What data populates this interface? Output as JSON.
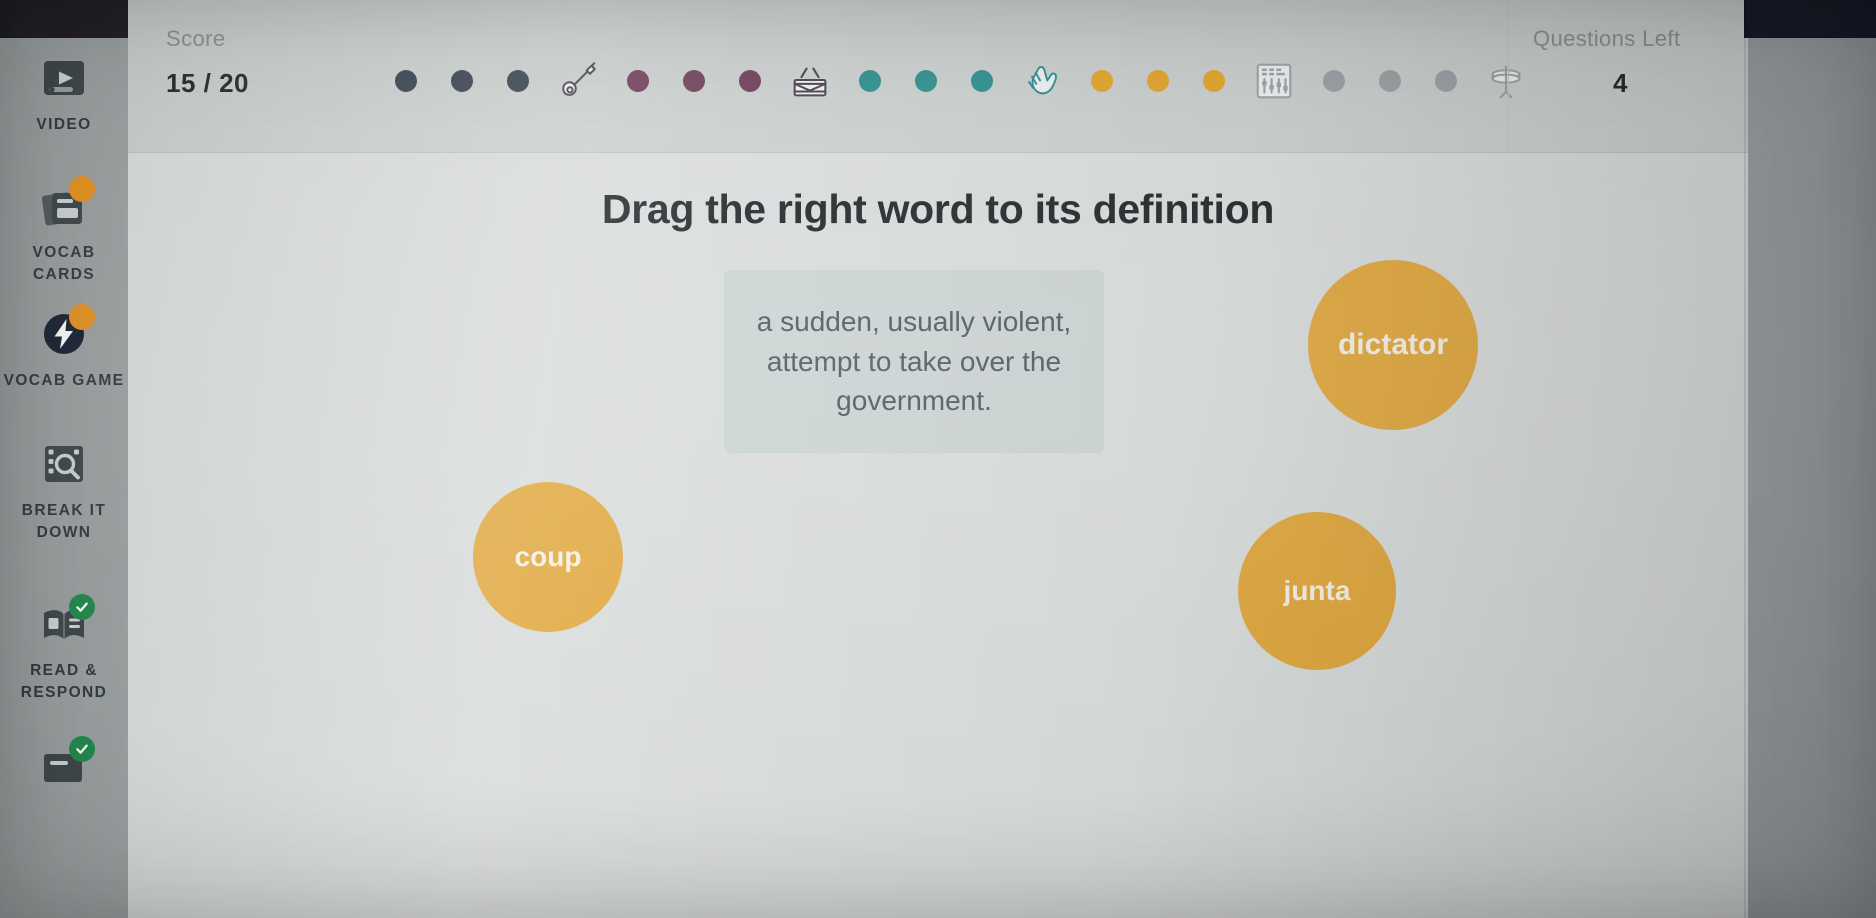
{
  "app": {
    "title": "Vocab Game"
  },
  "sidebar": {
    "items": [
      {
        "label": "VIDEO",
        "icon": "video-play-icon",
        "badge": "none"
      },
      {
        "label": "VOCAB CARDS",
        "icon": "flash-cards-icon",
        "badge": "orange"
      },
      {
        "label": "VOCAB GAME",
        "icon": "lightning-bolt-icon",
        "badge": "orange"
      },
      {
        "label": "BREAK IT\nDOWN",
        "icon": "film-search-icon",
        "badge": "none"
      },
      {
        "label": "READ &\nRESPOND",
        "icon": "open-book-icon",
        "badge": "green"
      },
      {
        "label": "",
        "icon": "write-note-icon",
        "badge": "green"
      }
    ]
  },
  "header": {
    "score_caption": "Score",
    "score_value": "15 / 20",
    "questions_left_caption": "Questions Left",
    "questions_left_value": "4"
  },
  "progress": {
    "milestone_icons": [
      "guitar-icon",
      "drum-icon",
      "clapping-hands-icon",
      "mixer-icon",
      "cymbal-icon"
    ],
    "segments": [
      {
        "color": "#2f3a48",
        "dots": 3,
        "icon": "guitar-icon"
      },
      {
        "color": "#6b3b56",
        "dots": 3,
        "icon": "drum-icon"
      },
      {
        "color": "#2b8e8c",
        "dots": 3,
        "icon": "clapping-hands-icon"
      },
      {
        "color": "#e0a329",
        "dots": 3,
        "icon": "mixer-icon"
      },
      {
        "color": "#9aa1a4",
        "dots": 3,
        "icon": "cymbal-icon"
      }
    ]
  },
  "game": {
    "prompt": "Drag the right word to its definition",
    "definition": "a sudden, usually violent, attempt to take over the government.",
    "word_bubbles": [
      {
        "id": "dictator",
        "label": "dictator"
      },
      {
        "id": "coup",
        "label": "coup"
      },
      {
        "id": "junta",
        "label": "junta"
      }
    ]
  },
  "colors": {
    "bubble": "#e0a63a",
    "accent_orange": "#e8921f",
    "accent_green": "#1f8a4c",
    "app_bg": "#d7dbda",
    "header_bg": "#c9cecd",
    "sidebar_bg": "#9ba0a1",
    "text_dark": "#1d2225",
    "text_muted": "#8b9194"
  }
}
